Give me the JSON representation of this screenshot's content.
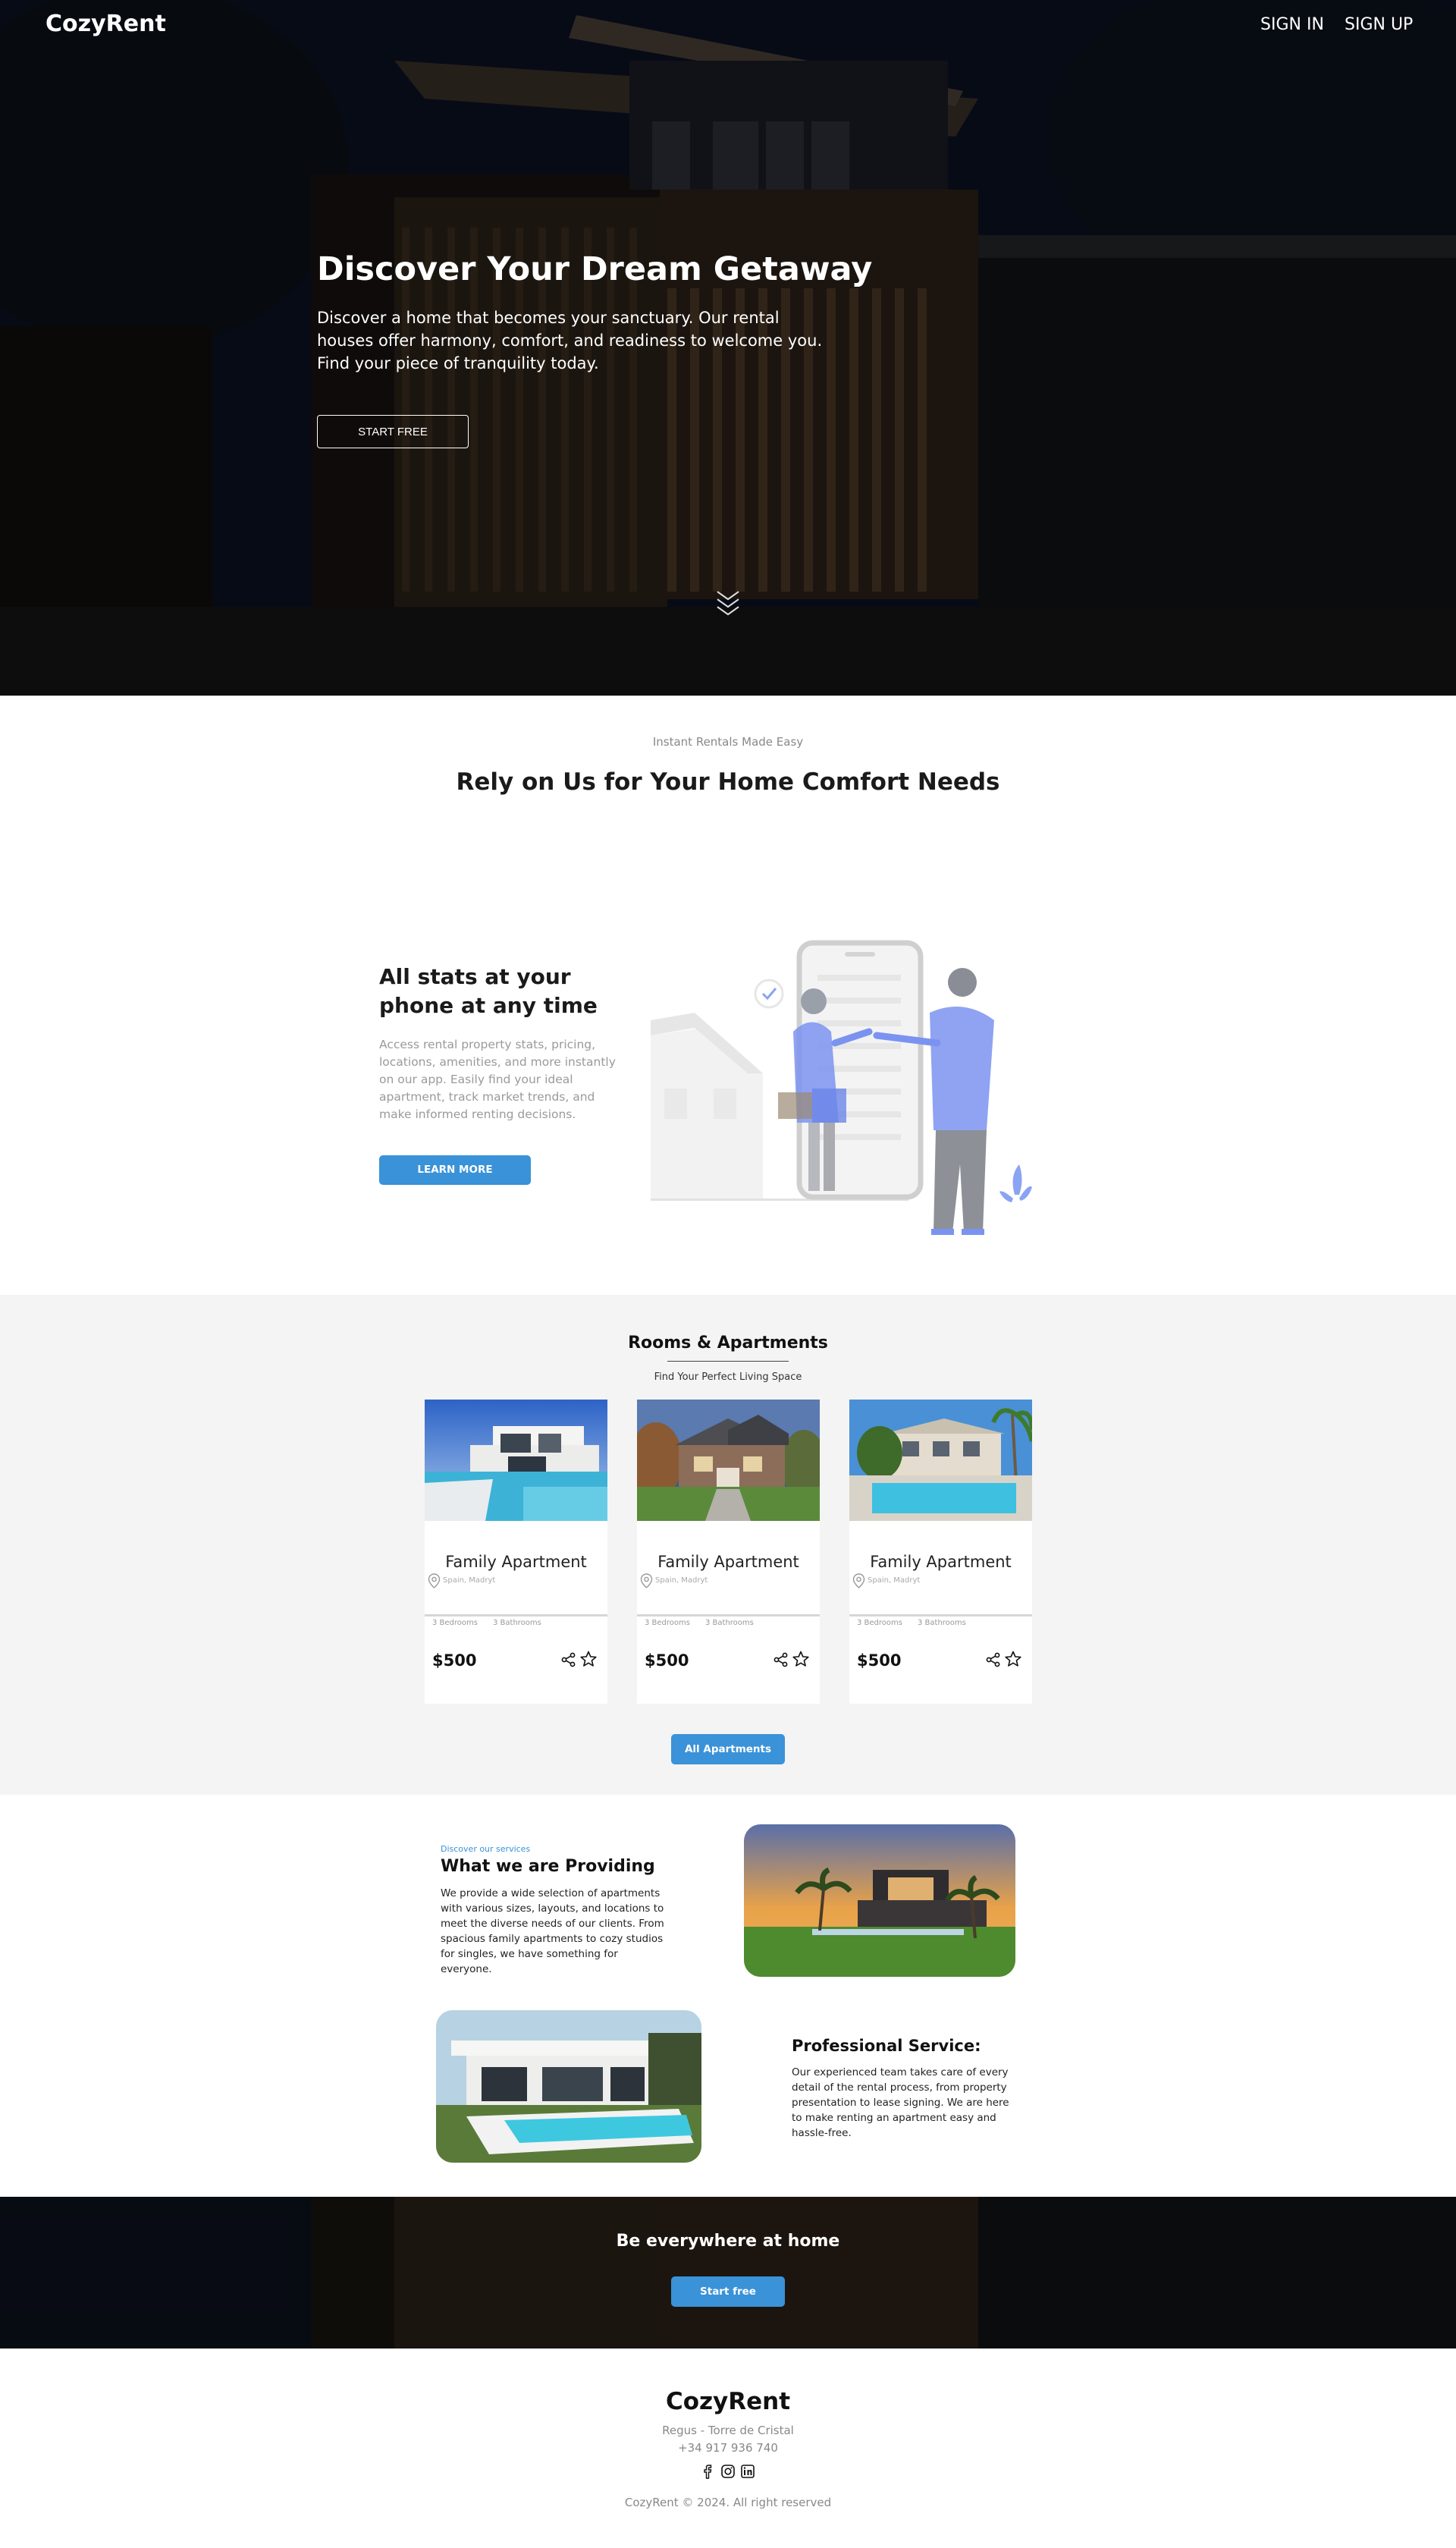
{
  "header": {
    "logo": "CozyRent",
    "sign_in": "SIGN IN",
    "sign_up": "SIGN UP"
  },
  "hero": {
    "title": "Discover Your Dream Getaway",
    "text": "Discover a home that becomes your sanctuary. Our rental houses offer harmony, comfort, and readiness to welcome you. Find your piece of tranquility today.",
    "button": "START FREE"
  },
  "intro": {
    "tagline": "Instant Rentals Made Easy",
    "title": "Rely on Us for Your Home Comfort Needs"
  },
  "stats": {
    "title": "All stats at your phone at any time",
    "text": "Access rental property stats, pricing, locations, amenities, and more instantly on our app. Easily find your ideal apartment, track market trends, and make informed renting decisions.",
    "button": "LEARN MORE"
  },
  "rooms": {
    "title": "Rooms & Apartments",
    "subtitle": "Find Your Perfect Living Space",
    "cards": [
      {
        "title": "Family Apartment",
        "location": "Spain, Madryt",
        "bedrooms": "3 Bedrooms",
        "bathrooms": "3 Bathrooms",
        "price": "$500"
      },
      {
        "title": "Family Apartment",
        "location": "Spain, Madryt",
        "bedrooms": "3 Bedrooms",
        "bathrooms": "3 Bathrooms",
        "price": "$500"
      },
      {
        "title": "Family Apartment",
        "location": "Spain, Madryt",
        "bedrooms": "3 Bedrooms",
        "bathrooms": "3 Bathrooms",
        "price": "$500"
      }
    ],
    "button": "All Apartments"
  },
  "services": {
    "tagline": "Discover our services",
    "title": "What we are Providing",
    "text": "We provide a wide selection of apartments with various sizes, layouts, and locations to meet the diverse needs of our clients. From spacious family apartments to cozy studios for singles, we have something for everyone.",
    "pro_title": "Professional Service:",
    "pro_text": "Our experienced team takes care of every detail of the rental process, from property presentation to lease signing. We are here to make renting an apartment easy and hassle-free."
  },
  "cta": {
    "title": "Be everywhere at home",
    "button": "Start free"
  },
  "footer": {
    "logo": "CozyRent",
    "address": "Regus - Torre de Cristal",
    "phone": "+34 917 936 740",
    "copyright": "CozyRent © 2024. All right reserved"
  },
  "colors": {
    "accent": "#3a92d8",
    "hero_bg": "#0e1322",
    "section_gray": "#f4f4f4",
    "illustration_blue": "#7b93f0"
  },
  "icons": [
    "chevrons-down-icon",
    "location-pin-icon",
    "share-icon",
    "star-icon",
    "facebook-icon",
    "instagram-icon",
    "linkedin-icon"
  ]
}
